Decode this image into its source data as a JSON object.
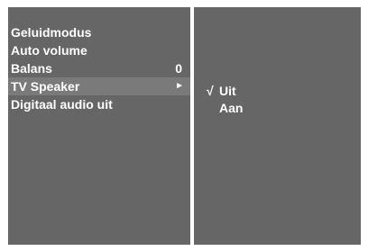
{
  "menu": {
    "items": [
      {
        "label": "Geluidmodus",
        "value": ""
      },
      {
        "label": "Auto volume",
        "value": ""
      },
      {
        "label": "Balans",
        "value": "0"
      },
      {
        "label": "TV Speaker",
        "value": "",
        "arrow": "►"
      },
      {
        "label": "Digitaal audio uit",
        "value": ""
      }
    ],
    "selected_index": 3
  },
  "submenu": {
    "options": [
      {
        "check": "√",
        "label": "Uit"
      },
      {
        "check": "",
        "label": "Aan"
      }
    ]
  },
  "colors": {
    "panel": "#666666",
    "highlight": "#7a7a7a",
    "text": "#ffffff",
    "background": "#ffffff"
  }
}
